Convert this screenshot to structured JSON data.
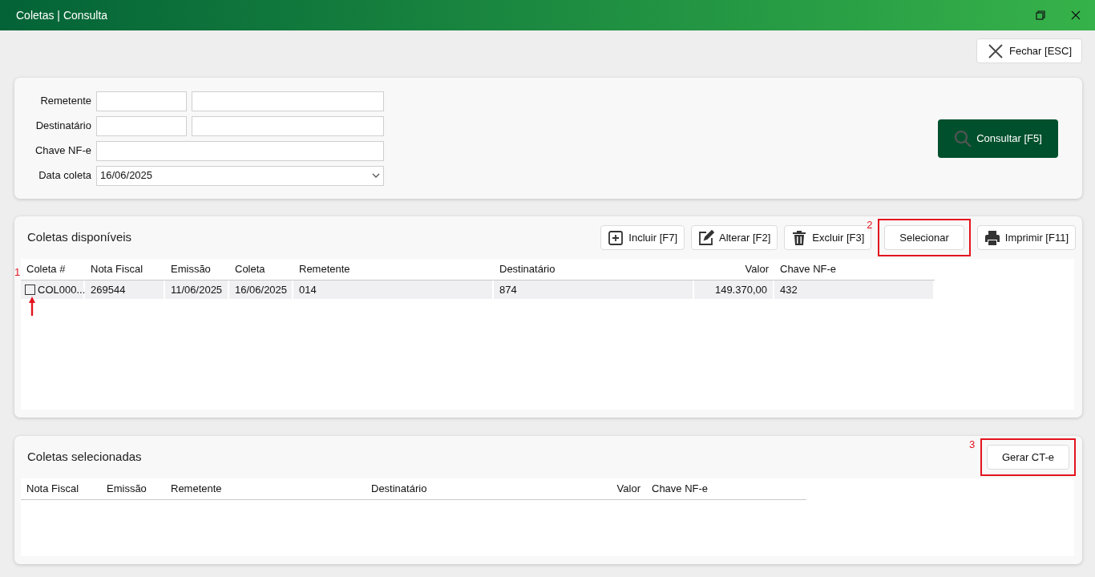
{
  "window": {
    "title": "Coletas | Consulta"
  },
  "close_button": {
    "label": "Fechar [ESC]"
  },
  "filters": {
    "fields": [
      {
        "label": "Remetente",
        "kind": "pair"
      },
      {
        "label": "Destinatário",
        "kind": "pair"
      },
      {
        "label": "Chave NF-e",
        "kind": "wide"
      },
      {
        "label": "Data coleta",
        "kind": "dropdown",
        "value": "16/06/2025"
      }
    ],
    "search_button": {
      "label": "Consultar [F5]"
    }
  },
  "available": {
    "title": "Coletas disponíveis",
    "buttons": [
      {
        "label": "Incluir [F7]"
      },
      {
        "label": "Alterar [F2]"
      },
      {
        "label": "Excluir [F3]"
      },
      {
        "label": "Selecionar",
        "annotation": "2"
      },
      {
        "label": "Imprimir [F11]"
      }
    ],
    "columns": [
      {
        "label": "Coleta #",
        "kind": "text"
      },
      {
        "label": "Nota Fiscal",
        "kind": "text"
      },
      {
        "label": "Emissão",
        "kind": "text"
      },
      {
        "label": "Coleta",
        "kind": "text"
      },
      {
        "label": "Remetente",
        "kind": "text"
      },
      {
        "label": "Destinatário",
        "kind": "text"
      },
      {
        "label": "Valor",
        "kind": "number"
      },
      {
        "label": "Chave NF-e",
        "kind": "text"
      }
    ],
    "rows": [
      {
        "checked": false,
        "annotation": "1",
        "cells": [
          "COL000...",
          "269544",
          "11/06/2025",
          "16/06/2025",
          "014",
          "874",
          "149.370,00",
          "432"
        ]
      }
    ]
  },
  "selected": {
    "title": "Coletas selecionadas",
    "buttons": [
      {
        "label": "Gerar CT-e",
        "annotation": "3"
      }
    ],
    "columns": [
      {
        "label": "Nota Fiscal",
        "kind": "text"
      },
      {
        "label": "Emissão",
        "kind": "text"
      },
      {
        "label": "Remetente",
        "kind": "text"
      },
      {
        "label": "Destinatário",
        "kind": "text"
      },
      {
        "label": "Valor",
        "kind": "number"
      },
      {
        "label": "Chave NF-e",
        "kind": "text"
      }
    ]
  }
}
